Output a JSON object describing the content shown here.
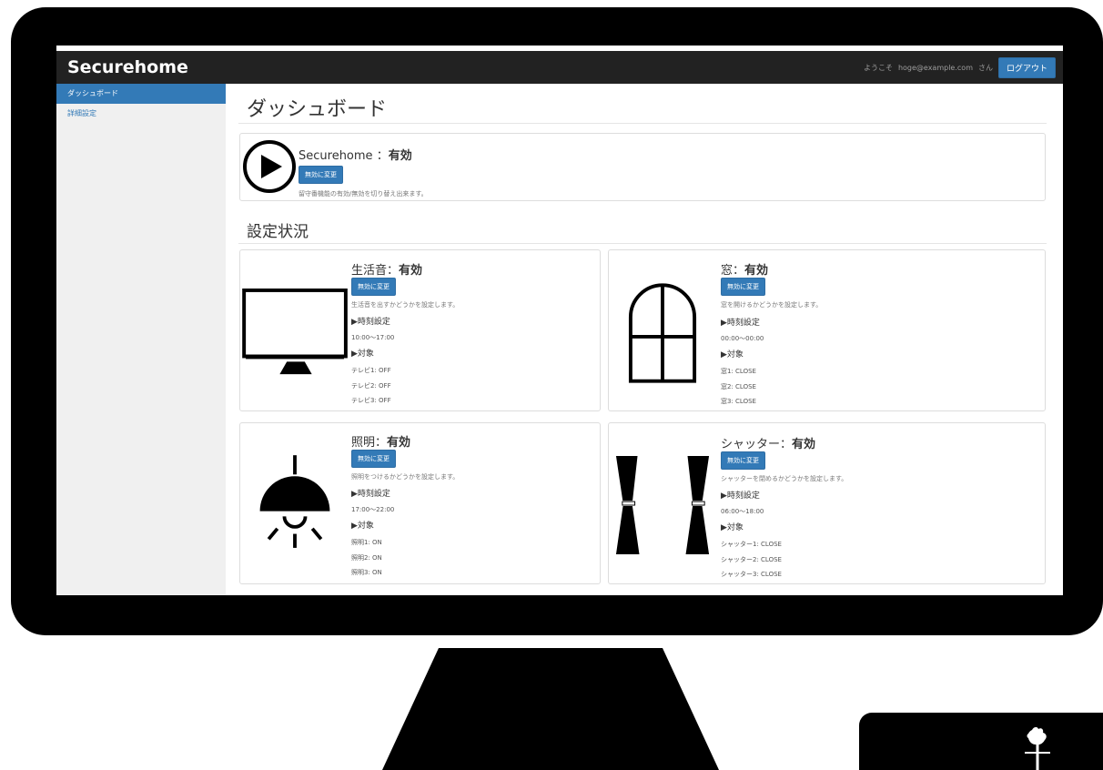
{
  "topbar": {
    "brand": "Securehome",
    "welcome": "ようこそ",
    "user_email": "hoge@example.com",
    "honorific": "さん",
    "logout_label": "ログアウト"
  },
  "sidebar": {
    "items": [
      {
        "label": "ダッシュボード"
      },
      {
        "label": "詳細設定"
      }
    ]
  },
  "main": {
    "title": "ダッシュボード",
    "status_heading": "設定状況"
  },
  "securehome_panel": {
    "name": "Securehome",
    "separator": "：",
    "state": "有効",
    "button": "無効に変更",
    "description": "留守番機能の有効/無効を切り替え出来ます。"
  },
  "settings": [
    {
      "name": "生活音",
      "separator": "：",
      "state": "有効",
      "button": "無効に変更",
      "description": "生活音を出すかどうかを設定します。",
      "time_heading": "▶時刻設定",
      "time": "10:00〜17:00",
      "target_heading": "▶対象",
      "targets": [
        {
          "name": "テレビ1:",
          "value": "OFF"
        },
        {
          "name": "テレビ2:",
          "value": "OFF"
        },
        {
          "name": "テレビ3:",
          "value": "OFF"
        }
      ]
    },
    {
      "name": "窓",
      "separator": "：",
      "state": "有効",
      "button": "無効に変更",
      "description": "窓を開けるかどうかを設定します。",
      "time_heading": "▶時刻設定",
      "time": "00:00〜00:00",
      "target_heading": "▶対象",
      "targets": [
        {
          "name": "窓1:",
          "value": "CLOSE"
        },
        {
          "name": "窓2:",
          "value": "CLOSE"
        },
        {
          "name": "窓3:",
          "value": "CLOSE"
        }
      ]
    },
    {
      "name": "照明",
      "separator": "：",
      "state": "有効",
      "button": "無効に変更",
      "description": "照明をつけるかどうかを設定します。",
      "time_heading": "▶時刻設定",
      "time": "17:00〜22:00",
      "target_heading": "▶対象",
      "targets": [
        {
          "name": "照明1:",
          "value": "ON"
        },
        {
          "name": "照明2:",
          "value": "ON"
        },
        {
          "name": "照明3:",
          "value": "ON"
        }
      ]
    },
    {
      "name": "シャッター",
      "separator": "：",
      "state": "有効",
      "button": "無効に変更",
      "description": "シャッターを閉めるかどうかを設定します。",
      "time_heading": "▶時刻設定",
      "time": "06:00〜18:00",
      "target_heading": "▶対象",
      "targets": [
        {
          "name": "シャッター1:",
          "value": "CLOSE"
        },
        {
          "name": "シャッター2:",
          "value": "CLOSE"
        },
        {
          "name": "シャッター3:",
          "value": "CLOSE"
        }
      ]
    }
  ],
  "icons": {
    "play": "play-circle-icon",
    "tv": "monitor-icon",
    "window": "window-icon",
    "lamp": "pendant-lamp-icon",
    "curtain": "curtain-icon",
    "rooster": "rooster-weathervane-icon"
  },
  "colors": {
    "primary": "#337ab7",
    "navbar": "#222222",
    "sidebar": "#f0f0f0",
    "frame": "#000000"
  }
}
